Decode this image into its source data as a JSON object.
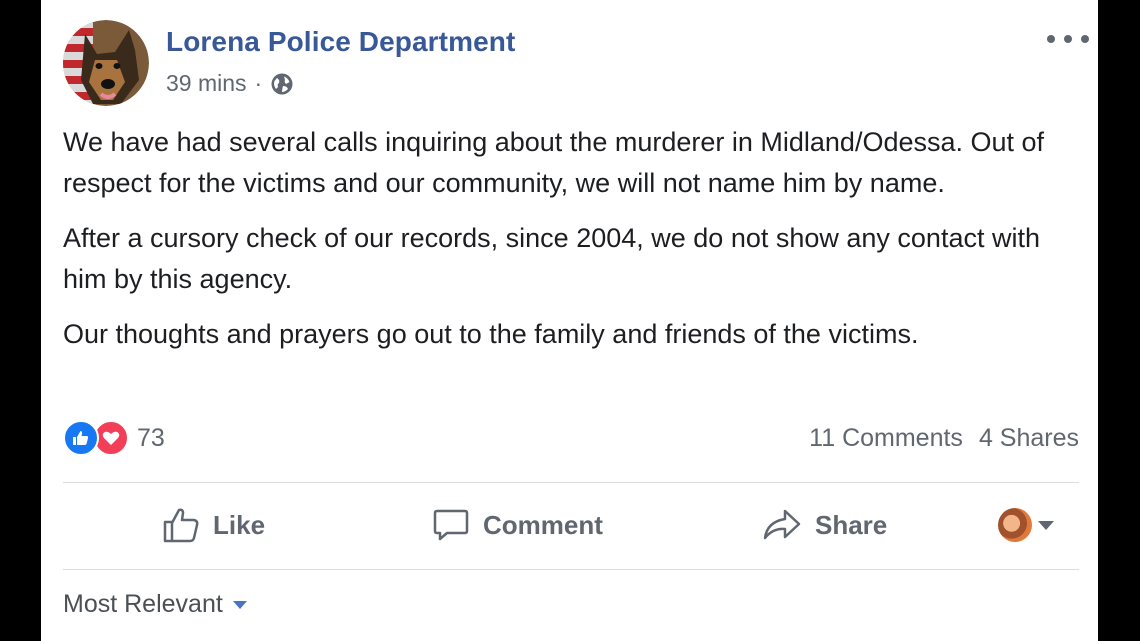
{
  "post": {
    "page_name": "Lorena Police Department",
    "time": "39 mins",
    "separator": "·",
    "privacy_icon": "globe-icon",
    "paragraphs": [
      "We have had several calls inquiring about the murderer in Midland/Odessa. Out of respect for the victims and our community, we will not name him by name.",
      "After a cursory check of our records, since 2004, we do not show any contact with him by this agency.",
      "Our thoughts and prayers go out to the family and friends of the victims."
    ]
  },
  "reactions": {
    "count": "73",
    "icons": [
      "like-reaction-icon",
      "love-reaction-icon"
    ]
  },
  "counts": {
    "comments": "11 Comments",
    "shares": "4 Shares"
  },
  "actions": {
    "like": "Like",
    "comment": "Comment",
    "share": "Share"
  },
  "comments_sort": {
    "label": "Most Relevant"
  },
  "colors": {
    "page_name": "#385898",
    "text": "#1c1e21",
    "secondary": "#606770",
    "like_blue": "#1877f2",
    "love_red": "#f33e58"
  }
}
